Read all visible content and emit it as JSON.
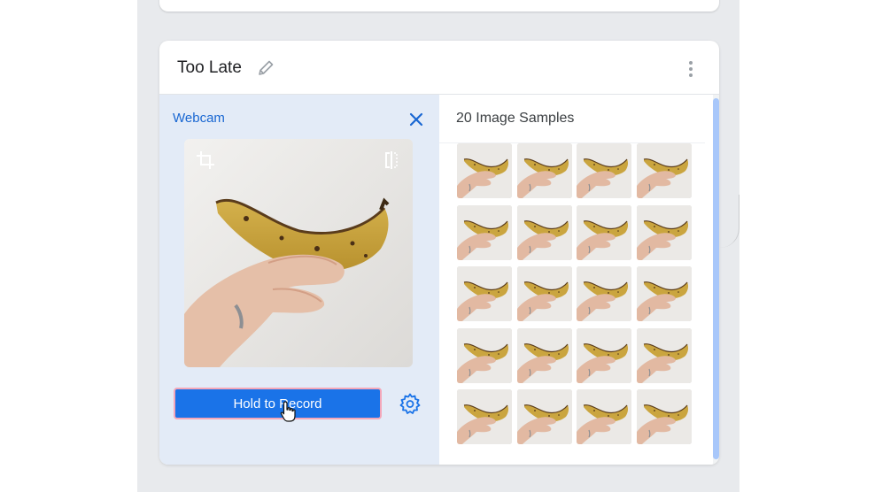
{
  "class_card": {
    "title": "Too Late",
    "webcam": {
      "label": "Webcam",
      "record_button": "Hold to Record"
    },
    "samples": {
      "count_label": "20 Image Samples",
      "thumbnails": [
        "banana",
        "banana",
        "banana",
        "banana",
        "banana",
        "banana",
        "banana",
        "banana",
        "banana",
        "banana",
        "banana",
        "banana",
        "banana",
        "banana",
        "banana",
        "banana",
        "banana",
        "banana",
        "banana",
        "banana"
      ]
    }
  },
  "icons": {
    "edit": "pencil-icon",
    "more": "more-vert-icon",
    "close": "close-icon",
    "crop": "crop-icon",
    "flip": "flip-icon",
    "settings": "gear-icon",
    "cursor": "hand-pointer-icon"
  },
  "colors": {
    "accent": "#1a73e8",
    "webcam_panel_bg": "#e3ebf7",
    "record_outline": "#f4a7b9",
    "scroll_thumb": "#a8c7fa"
  }
}
